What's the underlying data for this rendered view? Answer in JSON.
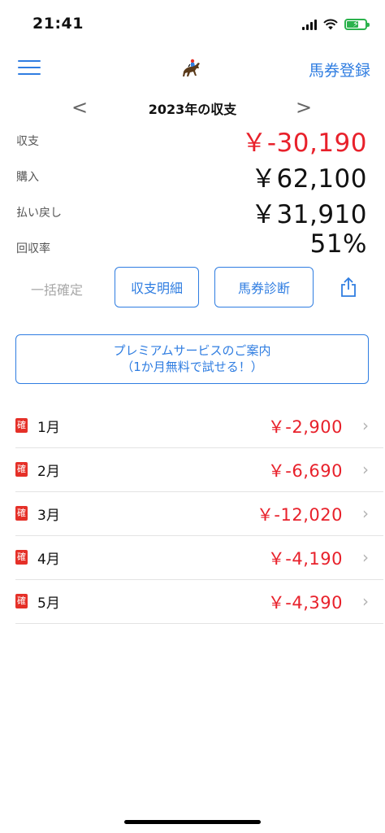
{
  "status_bar": {
    "time": "21:41"
  },
  "nav": {
    "right_label": "馬券登録"
  },
  "year": {
    "title": "2023年の収支",
    "prev": "<",
    "next": ">"
  },
  "summary": [
    {
      "label": "収支",
      "value": "￥-30,190",
      "color": "#e8212b"
    },
    {
      "label": "購入",
      "value": "￥62,100",
      "color": "#111111"
    },
    {
      "label": "払い戻し",
      "value": "￥31,910",
      "color": "#111111"
    },
    {
      "label": "回収率",
      "value": "51%",
      "color": "#111111"
    }
  ],
  "actions": {
    "ikkatsu": "一括確定",
    "detail_button": "収支明細",
    "diagnosis_button": "馬券診断"
  },
  "premium": {
    "line1": "プレミアムサービスのご案内",
    "line2": "（1か月無料で試せる！）"
  },
  "months": [
    {
      "badge": "確",
      "label": "1月",
      "value": "￥-2,900"
    },
    {
      "badge": "確",
      "label": "2月",
      "value": "￥-6,690"
    },
    {
      "badge": "確",
      "label": "3月",
      "value": "￥-12,020"
    },
    {
      "badge": "確",
      "label": "4月",
      "value": "￥-4,190"
    },
    {
      "badge": "確",
      "label": "5月",
      "value": "￥-4,390"
    }
  ],
  "colors": {
    "accent": "#2f7de1",
    "negative": "#e8212b",
    "badge": "#e53028"
  }
}
